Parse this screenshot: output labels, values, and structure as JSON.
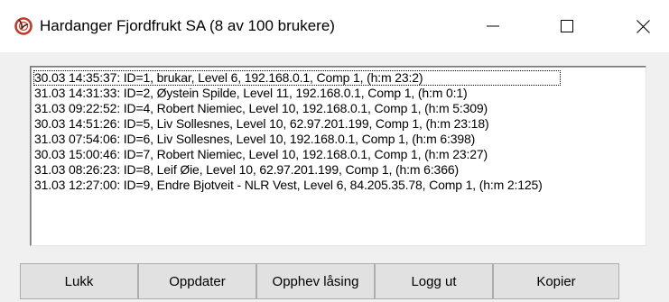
{
  "window": {
    "title": "Hardanger Fjordfrukt SA (8 av 100 brukere)",
    "icon": "app-icon",
    "controls": {
      "minimize_icon": "minimize-icon",
      "maximize_icon": "maximize-icon",
      "close_icon": "close-icon"
    }
  },
  "list": {
    "items": [
      "30.03 14:35:37: ID=1, brukar, Level 6, 192.168.0.1, Comp 1, (h:m 23:2)",
      "31.03 14:31:33: ID=2, Øystein Spilde, Level 11, 192.168.0.1, Comp 1, (h:m 0:1)",
      "31.03 09:22:52: ID=4, Robert Niemiec, Level 10, 192.168.0.1, Comp 1, (h:m 5:309)",
      "30.03 14:51:26: ID=5, Liv Sollesnes, Level 10, 62.97.201.199, Comp 1, (h:m 23:18)",
      "31.03 07:54:06: ID=6, Liv Sollesnes, Level 10, 192.168.0.1, Comp 1, (h:m 6:398)",
      "30.03 15:00:46: ID=7, Robert Niemiec, Level 10, 192.168.0.1, Comp 1, (h:m 23:27)",
      "31.03 08:26:23: ID=8, Leif Øie, Level 10, 62.97.201.199, Comp 1, (h:m 6:366)",
      "31.03 12:27:00: ID=9, Endre Bjotveit - NLR Vest, Level 6, 84.205.35.78, Comp 1, (h:m 2:125)"
    ]
  },
  "buttons": {
    "close_label": "Lukk",
    "refresh_label": "Oppdater",
    "unlock_label": "Opphev låsing",
    "logout_label": "Logg ut",
    "copy_label": "Kopier"
  },
  "colors": {
    "icon_red": "#c0392b",
    "background": "#f0f0f0",
    "button_face": "#e1e1e1"
  }
}
